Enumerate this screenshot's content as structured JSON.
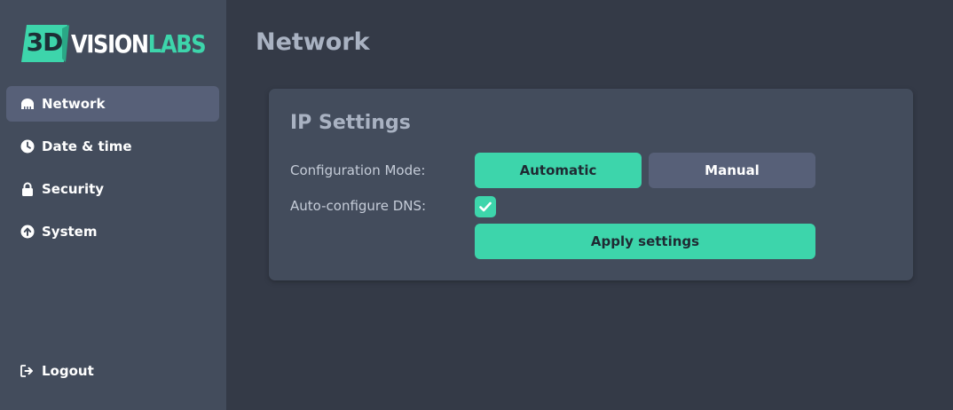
{
  "brand": {
    "logo_3d": "3D",
    "logo_word_1": "VISION",
    "logo_word_2": "LABS",
    "accent_color": "#3dd5ab"
  },
  "sidebar": {
    "items": [
      {
        "label": "Network",
        "icon": "network-icon",
        "active": true
      },
      {
        "label": "Date & time",
        "icon": "clock-icon",
        "active": false
      },
      {
        "label": "Security",
        "icon": "lock-icon",
        "active": false
      },
      {
        "label": "System",
        "icon": "upload-circle-icon",
        "active": false
      }
    ],
    "logout": {
      "label": "Logout",
      "icon": "logout-icon"
    }
  },
  "page": {
    "title": "Network"
  },
  "ip_settings": {
    "title": "IP Settings",
    "config_mode_label": "Configuration Mode:",
    "mode_automatic": "Automatic",
    "mode_manual": "Manual",
    "selected_mode": "Automatic",
    "dns_label": "Auto-configure DNS:",
    "dns_checked": true,
    "apply_label": "Apply settings"
  }
}
